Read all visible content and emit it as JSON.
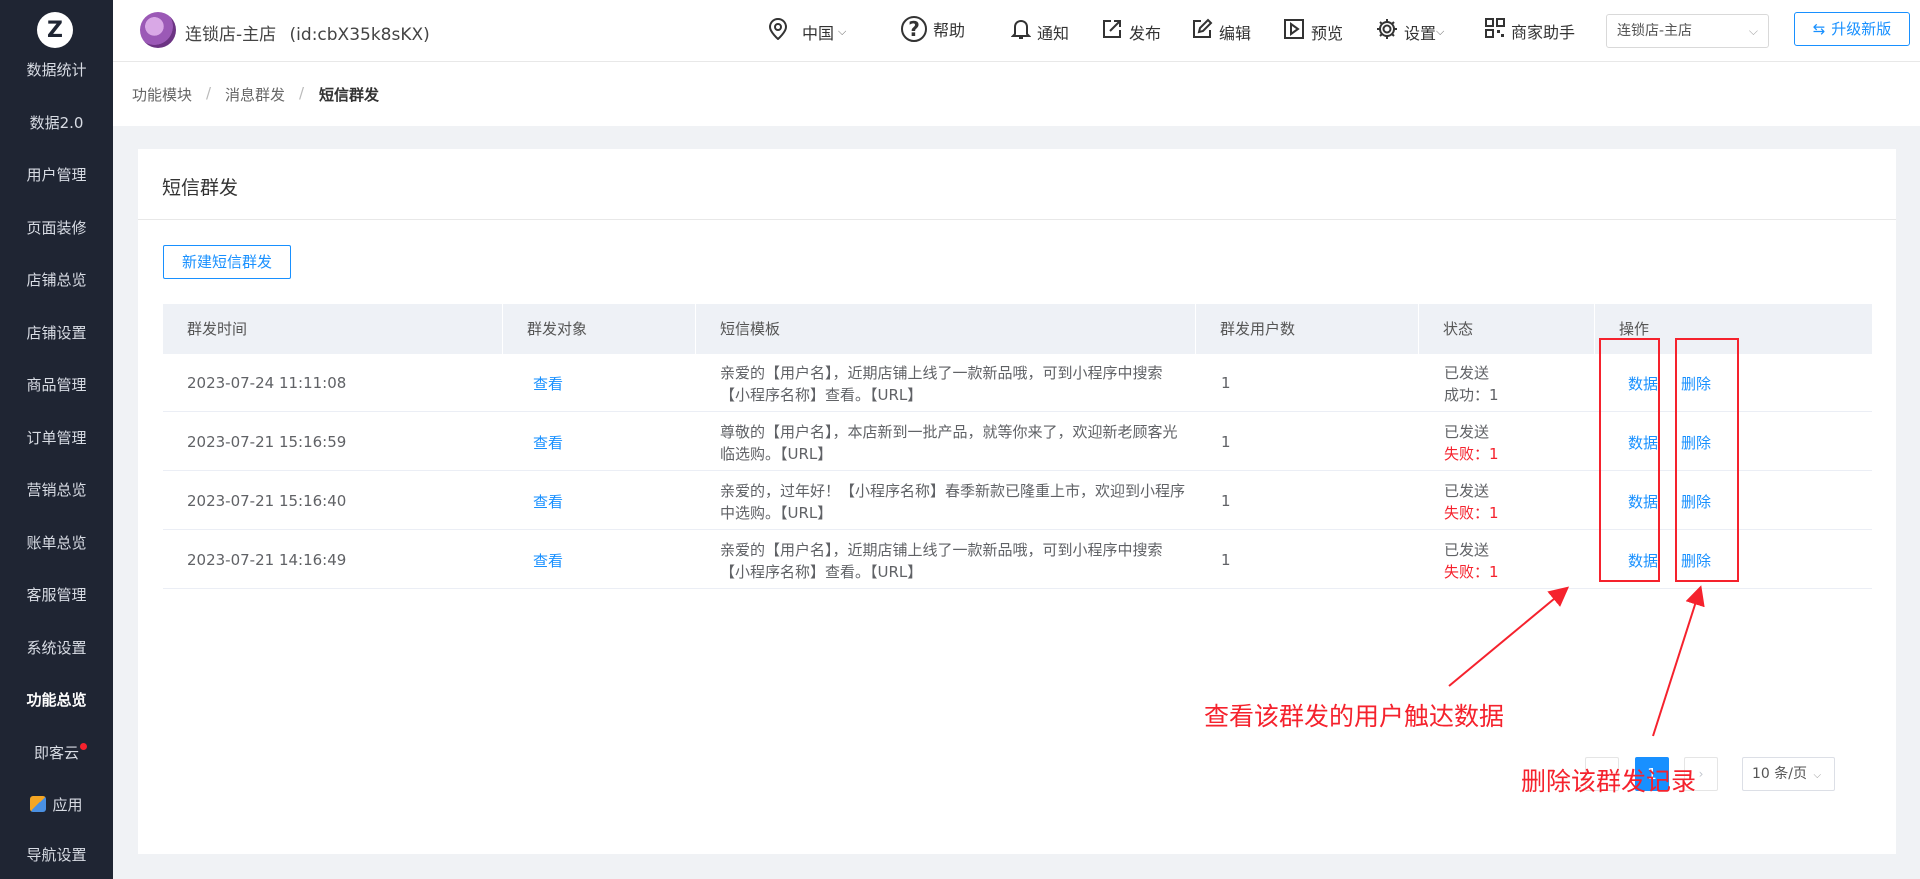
{
  "sidebar": {
    "logo_letter": "Z",
    "items": [
      {
        "label": "数据统计"
      },
      {
        "label": "数据2.0"
      },
      {
        "label": "用户管理"
      },
      {
        "label": "页面装修"
      },
      {
        "label": "店铺总览"
      },
      {
        "label": "店铺设置"
      },
      {
        "label": "商品管理"
      },
      {
        "label": "订单管理"
      },
      {
        "label": "营销总览"
      },
      {
        "label": "账单总览"
      },
      {
        "label": "客服管理"
      },
      {
        "label": "系统设置"
      },
      {
        "label": "功能总览"
      },
      {
        "label": "即客云"
      },
      {
        "label": "应用"
      },
      {
        "label": "导航设置"
      }
    ]
  },
  "header": {
    "store_name": "连锁店-主店",
    "store_id": "(id:cbX35k8sKX)",
    "region": "中国",
    "help": "帮助",
    "notify": "通知",
    "publish": "发布",
    "edit": "编辑",
    "preview": "预览",
    "settings": "设置",
    "merchant_helper": "商家助手",
    "store_select": "连锁店-主店",
    "upgrade": "升级新版"
  },
  "breadcrumb": {
    "items": [
      "功能模块",
      "消息群发",
      "短信群发"
    ],
    "separator": "/"
  },
  "page": {
    "title": "短信群发",
    "new_button": "新建短信群发"
  },
  "table": {
    "columns": [
      "群发时间",
      "群发对象",
      "短信模板",
      "群发用户数",
      "状态",
      "操作"
    ],
    "rows": [
      {
        "time": "2023-07-24 11:11:08",
        "target": "查看",
        "template_line1": "亲爱的【用户名】，近期店铺上线了一款新品哦，可到小程序中搜索",
        "template_line2": "【小程序名称】查看。【URL】",
        "users": "1",
        "status": "已发送",
        "result": "成功：1",
        "result_type": "success",
        "action_data": "数据",
        "action_delete": "删除"
      },
      {
        "time": "2023-07-21 15:16:59",
        "target": "查看",
        "template_line1": "尊敬的【用户名】，本店新到一批产品，就等你来了，欢迎新老顾客光",
        "template_line2": "临选购。【URL】",
        "users": "1",
        "status": "已发送",
        "result": "失败：1",
        "result_type": "fail",
        "action_data": "数据",
        "action_delete": "删除"
      },
      {
        "time": "2023-07-21 15:16:40",
        "target": "查看",
        "template_line1": "亲爱的，过年好！【小程序名称】春季新款已隆重上市，欢迎到小程序",
        "template_line2": "中选购。【URL】",
        "users": "1",
        "status": "已发送",
        "result": "失败：1",
        "result_type": "fail",
        "action_data": "数据",
        "action_delete": "删除"
      },
      {
        "time": "2023-07-21 14:16:49",
        "target": "查看",
        "template_line1": "亲爱的【用户名】，近期店铺上线了一款新品哦，可到小程序中搜索",
        "template_line2": "【小程序名称】查看。【URL】",
        "users": "1",
        "status": "已发送",
        "result": "失败：1",
        "result_type": "fail",
        "action_data": "数据",
        "action_delete": "删除"
      }
    ]
  },
  "pagination": {
    "prev": "‹",
    "current": "1",
    "next": "›",
    "page_size": "10 条/页"
  },
  "annotations": {
    "data_note": "查看该群发的用户触达数据",
    "delete_note": "删除该群发记录",
    "color": "#f5222d"
  },
  "colors": {
    "accent": "#1890ff",
    "sidebar_bg": "#1f2533",
    "fail": "#f5222d"
  }
}
